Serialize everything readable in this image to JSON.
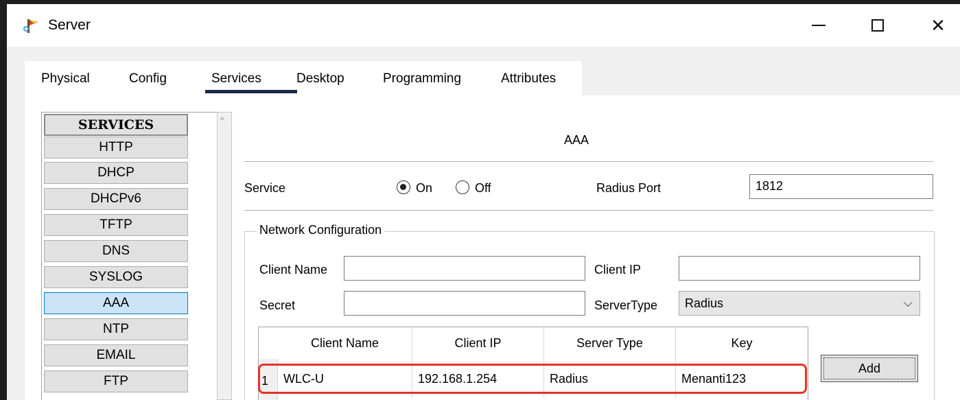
{
  "window": {
    "title": "Server",
    "icon": "packet-tracer-server-icon"
  },
  "window_controls": {
    "minimize": "minimize-icon",
    "maximize": "maximize-icon",
    "close": "✕"
  },
  "tabs": [
    {
      "label": "Physical"
    },
    {
      "label": "Config"
    },
    {
      "label": "Services",
      "selected": true
    },
    {
      "label": "Desktop"
    },
    {
      "label": "Programming"
    },
    {
      "label": "Attributes"
    }
  ],
  "services": {
    "header": "SERVICES",
    "items": [
      {
        "label": "HTTP"
      },
      {
        "label": "DHCP"
      },
      {
        "label": "DHCPv6"
      },
      {
        "label": "TFTP"
      },
      {
        "label": "DNS"
      },
      {
        "label": "SYSLOG"
      },
      {
        "label": "AAA",
        "selected": true
      },
      {
        "label": "NTP"
      },
      {
        "label": "EMAIL"
      },
      {
        "label": "FTP"
      }
    ]
  },
  "aaa": {
    "title": "AAA",
    "service_label": "Service",
    "on_label": "On",
    "off_label": "Off",
    "service_state": "On",
    "radius_port_label": "Radius Port",
    "radius_port_value": "1812",
    "network_config_legend": "Network Configuration",
    "client_name_label": "Client Name",
    "client_name_value": "",
    "client_ip_label": "Client IP",
    "client_ip_value": "",
    "secret_label": "Secret",
    "secret_value": "",
    "server_type_label": "ServerType",
    "server_type_value": "Radius",
    "add_label": "Add",
    "table": {
      "headers": [
        "Client Name",
        "Client IP",
        "Server Type",
        "Key"
      ],
      "rows": [
        {
          "num": "1",
          "client_name": "WLC-U",
          "client_ip": "192.168.1.254",
          "server_type": "Radius",
          "key": "Menanti123"
        }
      ]
    }
  },
  "colors": {
    "accent": "#1a2a44",
    "selection": "#cce4f7",
    "highlight": "#e3322b"
  }
}
